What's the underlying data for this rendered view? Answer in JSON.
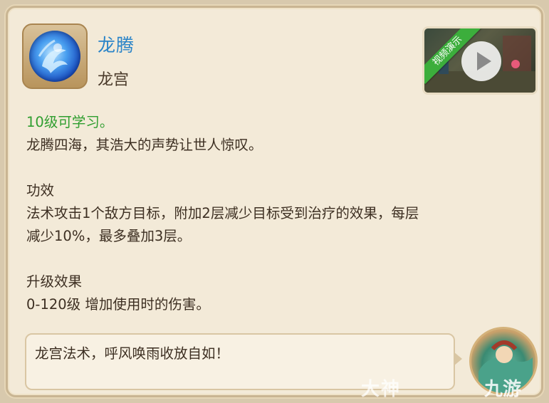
{
  "skill": {
    "name": "龙腾",
    "school": "龙宫",
    "icon": "dragon-orb-icon"
  },
  "video": {
    "ribbon_label": "视频演示",
    "play_icon": "play-icon"
  },
  "description": {
    "learn_level": "10级可学习。",
    "flavor": "龙腾四海，其浩大的声势让世人惊叹。",
    "effect_heading": "功效",
    "effect_line1": "法术攻击1个敌方目标，附加2层减少目标受到治疗的效果，每层",
    "effect_line2": "减少10%，最多叠加3层。",
    "upgrade_heading": "升级效果",
    "upgrade_line": "0-120级 增加使用时的伤害。"
  },
  "quote": {
    "text": "龙宫法术，呼风唤雨收放自如！"
  },
  "watermarks": {
    "left": "大神",
    "right": "九游"
  },
  "colors": {
    "name_blue": "#2a84c8",
    "learn_green": "#2f9e2f",
    "ribbon_green": "#3cae3c"
  }
}
